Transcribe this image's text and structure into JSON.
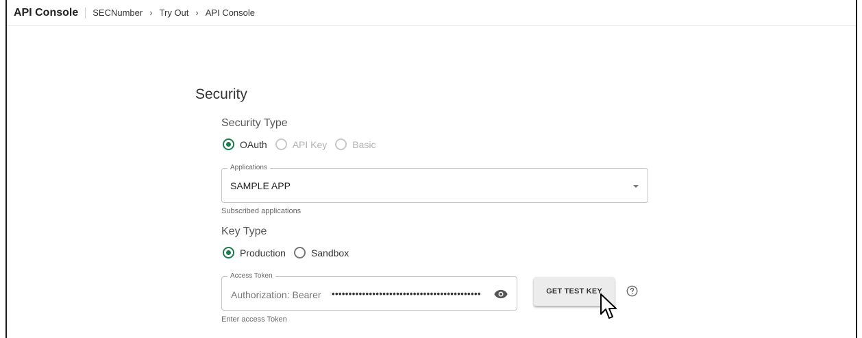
{
  "header": {
    "title": "API Console",
    "breadcrumbs": [
      "SECNumber",
      "Try Out",
      "API Console"
    ],
    "chevron": "›"
  },
  "security": {
    "title": "Security",
    "security_type": {
      "label": "Security Type",
      "options": [
        {
          "label": "OAuth",
          "selected": true,
          "enabled": true
        },
        {
          "label": "API Key",
          "selected": false,
          "enabled": false
        },
        {
          "label": "Basic",
          "selected": false,
          "enabled": false
        }
      ]
    },
    "applications": {
      "legend": "Applications",
      "value": "SAMPLE APP",
      "helper": "Subscribed applications"
    },
    "key_type": {
      "label": "Key Type",
      "options": [
        {
          "label": "Production",
          "selected": true
        },
        {
          "label": "Sandbox",
          "selected": false
        }
      ]
    },
    "access_token": {
      "legend": "Access Token",
      "prefix": "Authorization: Bearer",
      "masked": "••••••••••••••••••••••••••••••••••••••••••••",
      "helper": "Enter access Token"
    },
    "get_test_key": "GET TEST KEY"
  },
  "icons": {
    "eye": "eye-icon",
    "help": "help-circle-icon",
    "cursor": "mouse-pointer-icon",
    "dropdown": "caret-down-icon"
  },
  "colors": {
    "accent": "#1e7d4f",
    "button_bg": "#ececec"
  }
}
